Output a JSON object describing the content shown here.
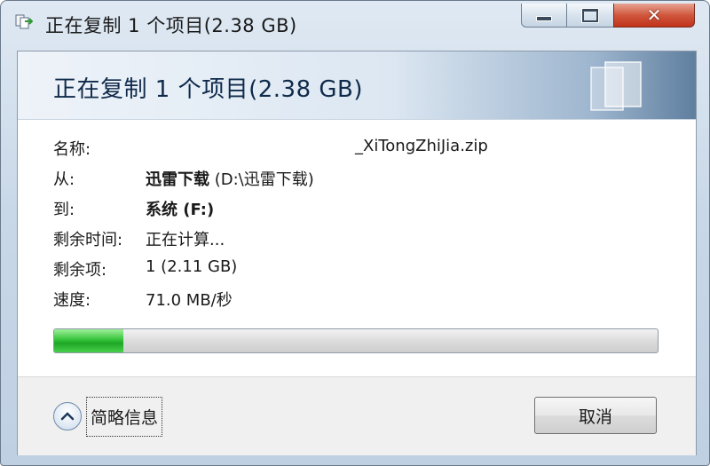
{
  "window": {
    "title": "正在复制 1 个项目(2.38 GB)"
  },
  "banner": {
    "title": "正在复制 1 个项目(2.38 GB)"
  },
  "details": {
    "name_label": "名称:",
    "name_value": "_XiTongZhiJia.zip",
    "from_label": "从:",
    "from_bold": "迅雷下载",
    "from_path": "(D:\\迅雷下载)",
    "to_label": "到:",
    "to_bold": "系统 (F:)",
    "time_label": "剩余时间:",
    "time_value": "正在计算...",
    "items_label": "剩余项:",
    "items_value": "1 (2.11 GB)",
    "speed_label": "速度:",
    "speed_value": "71.0 MB/秒"
  },
  "progress": {
    "fraction": 0.115
  },
  "footer": {
    "toggle_label": "简略信息",
    "cancel_label": "取消"
  },
  "icons": {
    "title": "copy-window-icon",
    "toggle": "chevron-up-icon",
    "close": "close-icon",
    "minimize": "minimize-icon",
    "maximize": "maximize-icon",
    "banner": "document-pages-icon"
  },
  "colors": {
    "progress_green": "#35c33a",
    "close_red": "#c0321a",
    "banner_title": "#0f2a4a"
  }
}
